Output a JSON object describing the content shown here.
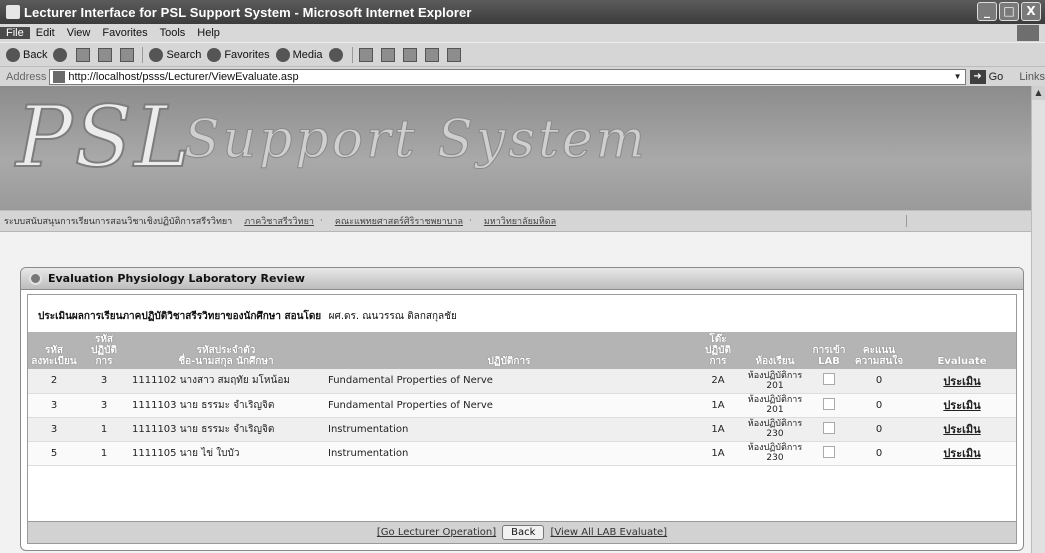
{
  "window": {
    "title": "Lecturer Interface for PSL Support System - Microsoft Internet Explorer",
    "buttons": [
      "_",
      "□",
      "X"
    ]
  },
  "menu": [
    "File",
    "Edit",
    "View",
    "Favorites",
    "Tools",
    "Help"
  ],
  "toolbar": {
    "back": "Back",
    "search": "Search",
    "favorites": "Favorites",
    "media": "Media"
  },
  "address": {
    "label": "Address",
    "url": "http://localhost/psss/Lecturer/ViewEvaluate.asp",
    "go": "Go",
    "links": "Links"
  },
  "banner": {
    "logo": "PSL",
    "subtitle": "Support System"
  },
  "nav": {
    "home": "ระบบสนับสนุนการเรียนการสอนวิชาเชิงปฏิบัติการสรีรวิทยา",
    "links": [
      "ภาควิชาสรีรวิทยา",
      "คณะแพทยศาสตร์ศิริราชพยาบาล",
      "มหาวิทยาลัยมหิดล"
    ]
  },
  "panel": {
    "title": "Evaluation Physiology Laboratory Review",
    "heading": "ประเมินผลการเรียนภาคปฏิบัติวิชาสรีรวิทยาของนักศึกษา สอนโดย",
    "lecturer": "ผศ.ดร. ณนวรรณ   ติลกสกุลชัย"
  },
  "table": {
    "headers": [
      [
        "รหัส",
        "ลงทะเบียน"
      ],
      [
        "รหัส",
        "ปฏิบัติการ"
      ],
      [
        "รหัสประจำตัว",
        "ชื่อ-นามสกุล นักศึกษา"
      ],
      [
        "ปฏิบัติการ"
      ],
      [
        "โต๊ะ",
        "ปฏิบัติการ"
      ],
      [
        "ห้องเรียน"
      ],
      [
        "การเข้า",
        "LAB"
      ],
      [
        "คะแนน",
        "ความสนใจ"
      ],
      [
        "Evaluate"
      ]
    ],
    "rows": [
      {
        "reg": "2",
        "lab": "3",
        "student": "1111102 นางสาว สมฤทัย มโหน้อม",
        "practice": "Fundamental Properties of Nerve",
        "table": "2A",
        "room1": "ห้องปฏิบัติการ",
        "room2": "201",
        "score": "0",
        "eval": "ประเมิน"
      },
      {
        "reg": "3",
        "lab": "3",
        "student": "1111103 นาย ธรรมะ จำเริญจิต",
        "practice": "Fundamental Properties of Nerve",
        "table": "1A",
        "room1": "ห้องปฏิบัติการ",
        "room2": "201",
        "score": "0",
        "eval": "ประเมิน"
      },
      {
        "reg": "3",
        "lab": "1",
        "student": "1111103 นาย ธรรมะ จำเริญจิต",
        "practice": "Instrumentation",
        "table": "1A",
        "room1": "ห้องปฏิบัติการ",
        "room2": "230",
        "score": "0",
        "eval": "ประเมิน"
      },
      {
        "reg": "5",
        "lab": "1",
        "student": "1111105 นาย ไข่ ใบบัว",
        "practice": "Instrumentation",
        "table": "1A",
        "room1": "ห้องปฏิบัติการ",
        "room2": "230",
        "score": "0",
        "eval": "ประเมิน"
      }
    ]
  },
  "footer": {
    "go_lecturer": "[Go Lecturer Operation]",
    "back": "Back",
    "view_all": "[View All LAB Evaluate]"
  }
}
